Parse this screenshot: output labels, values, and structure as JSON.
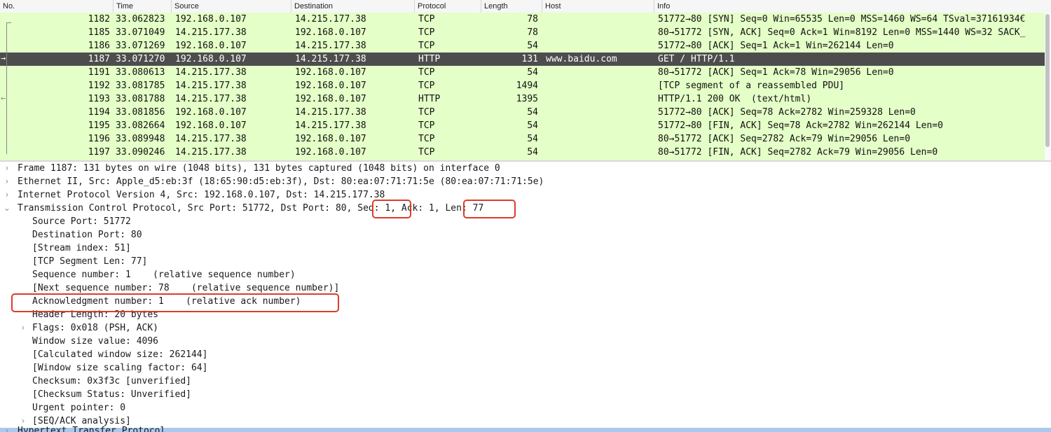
{
  "columns": {
    "no": "No.",
    "time": "Time",
    "source": "Source",
    "destination": "Destination",
    "protocol": "Protocol",
    "length": "Length",
    "host": "Host",
    "info": "Info"
  },
  "packets": [
    {
      "no": "1182",
      "time": "33.062823",
      "src": "192.168.0.107",
      "dst": "14.215.177.38",
      "proto": "TCP",
      "len": "78",
      "host": "",
      "info": "51772→80 [SYN] Seq=0 Win=65535 Len=0 MSS=1460 WS=64 TSval=37161934€"
    },
    {
      "no": "1185",
      "time": "33.071049",
      "src": "14.215.177.38",
      "dst": "192.168.0.107",
      "proto": "TCP",
      "len": "78",
      "host": "",
      "info": "80→51772 [SYN, ACK] Seq=0 Ack=1 Win=8192 Len=0 MSS=1440 WS=32 SACK_"
    },
    {
      "no": "1186",
      "time": "33.071269",
      "src": "192.168.0.107",
      "dst": "14.215.177.38",
      "proto": "TCP",
      "len": "54",
      "host": "",
      "info": "51772→80 [ACK] Seq=1 Ack=1 Win=262144 Len=0"
    },
    {
      "no": "1187",
      "time": "33.071270",
      "src": "192.168.0.107",
      "dst": "14.215.177.38",
      "proto": "HTTP",
      "len": "131",
      "host": "www.baidu.com",
      "info": "GET / HTTP/1.1"
    },
    {
      "no": "1191",
      "time": "33.080613",
      "src": "14.215.177.38",
      "dst": "192.168.0.107",
      "proto": "TCP",
      "len": "54",
      "host": "",
      "info": "80→51772 [ACK] Seq=1 Ack=78 Win=29056 Len=0"
    },
    {
      "no": "1192",
      "time": "33.081785",
      "src": "14.215.177.38",
      "dst": "192.168.0.107",
      "proto": "TCP",
      "len": "1494",
      "host": "",
      "info": "[TCP segment of a reassembled PDU]"
    },
    {
      "no": "1193",
      "time": "33.081788",
      "src": "14.215.177.38",
      "dst": "192.168.0.107",
      "proto": "HTTP",
      "len": "1395",
      "host": "",
      "info": "HTTP/1.1 200 OK  (text/html)"
    },
    {
      "no": "1194",
      "time": "33.081856",
      "src": "192.168.0.107",
      "dst": "14.215.177.38",
      "proto": "TCP",
      "len": "54",
      "host": "",
      "info": "51772→80 [ACK] Seq=78 Ack=2782 Win=259328 Len=0"
    },
    {
      "no": "1195",
      "time": "33.082664",
      "src": "192.168.0.107",
      "dst": "14.215.177.38",
      "proto": "TCP",
      "len": "54",
      "host": "",
      "info": "51772→80 [FIN, ACK] Seq=78 Ack=2782 Win=262144 Len=0"
    },
    {
      "no": "1196",
      "time": "33.089948",
      "src": "14.215.177.38",
      "dst": "192.168.0.107",
      "proto": "TCP",
      "len": "54",
      "host": "",
      "info": "80→51772 [ACK] Seq=2782 Ack=79 Win=29056 Len=0"
    },
    {
      "no": "1197",
      "time": "33.090246",
      "src": "14.215.177.38",
      "dst": "192.168.0.107",
      "proto": "TCP",
      "len": "54",
      "host": "",
      "info": "80→51772 [FIN, ACK] Seq=2782 Ack=79 Win=29056 Len=0"
    }
  ],
  "selected_packet": "1187",
  "details": {
    "frame": "Frame 1187: 131 bytes on wire (1048 bits), 131 bytes captured (1048 bits) on interface 0",
    "ethernet": "Ethernet II, Src: Apple_d5:eb:3f (18:65:90:d5:eb:3f), Dst: 80:ea:07:71:71:5e (80:ea:07:71:71:5e)",
    "ip": "Internet Protocol Version 4, Src: 192.168.0.107, Dst: 14.215.177.38",
    "tcp": "Transmission Control Protocol, Src Port: 51772, Dst Port: 80, Seq: 1, Ack: 1, Len: 77",
    "tcp_fields": {
      "src_port": "Source Port: 51772",
      "dst_port": "Destination Port: 80",
      "stream_index": "[Stream index: 51]",
      "segment_len": "[TCP Segment Len: 77]",
      "seq": "Sequence number: 1    (relative sequence number)",
      "next_seq": "[Next sequence number: 78    (relative sequence number)]",
      "ack": "Acknowledgment number: 1    (relative ack number)",
      "header_len": "Header Length: 20 bytes",
      "flags": "Flags: 0x018 (PSH, ACK)",
      "window": "Window size value: 4096",
      "calc_window": "[Calculated window size: 262144]",
      "scaling": "[Window size scaling factor: 64]",
      "checksum": "Checksum: 0x3f3c [unverified]",
      "checksum_status": "[Checksum Status: Unverified]",
      "urgent": "Urgent pointer: 0",
      "seq_ack_analysis": "[SEQ/ACK analysis]"
    },
    "next_layer": "Hypertext Transfer Protocol"
  },
  "icons": {
    "collapsed": "chevron-right-icon",
    "expanded": "chevron-down-icon"
  },
  "colors": {
    "tcp_row": "#e4ffc7",
    "selected_row": "#4d4d4d",
    "highlight": "#dc3b2a",
    "next_layer_band": "#a9c9ef"
  }
}
